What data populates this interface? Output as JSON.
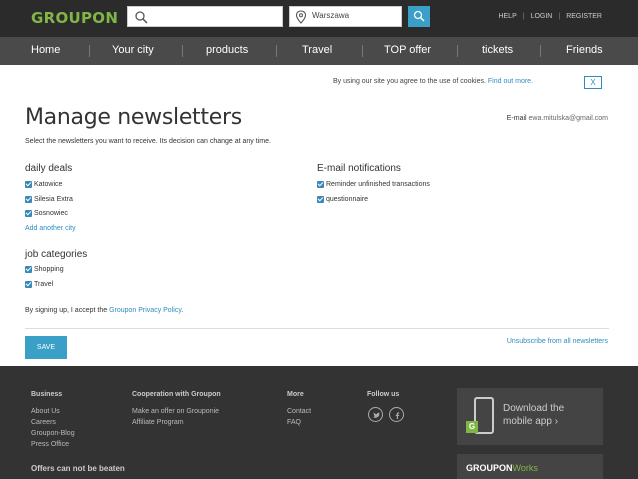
{
  "header": {
    "logo": "GROUPON",
    "search_placeholder": "",
    "location_value": "Warszawa",
    "links": [
      "HELP",
      "LOGIN",
      "REGISTER"
    ]
  },
  "nav": {
    "items": [
      "Home",
      "Your city",
      "products",
      "Travel",
      "TOP offer",
      "tickets",
      "Friends"
    ]
  },
  "cookie": {
    "text": "By using our site you agree to the use of cookies.",
    "link": "Find out more.",
    "close": "X"
  },
  "main": {
    "title": "Manage newsletters",
    "email_label": "E-mail",
    "email_value": "ewa.mitulska@gmail.com",
    "subtitle": "Select the newsletters you want to receive. Its decision can change at any time.",
    "daily_deals": {
      "heading": "daily deals",
      "items": [
        "Katowice",
        "Silesia Extra",
        "Sosnowiec"
      ],
      "add_link": "Add another city"
    },
    "email_notifications": {
      "heading": "E-mail notifications",
      "items": [
        "Reminder unfinished transactions",
        "questionnaire"
      ]
    },
    "job_categories": {
      "heading": "job categories",
      "items": [
        "Shopping",
        "Travel"
      ]
    },
    "terms_text": "By signing up, I accept the",
    "terms_link": "Groupon Privacy Policy",
    "terms_end": ".",
    "save_label": "SAVE",
    "unsubscribe_label": "Unsubscribe from all newsletters"
  },
  "footer": {
    "business": {
      "heading": "Business",
      "items": [
        "About Us",
        "Careers",
        "Groupon-Blog",
        "Press Office"
      ]
    },
    "cooperation": {
      "heading": "Cooperation with Groupon",
      "items": [
        "Make an offer on Grouponie",
        "Affiliate Program"
      ]
    },
    "more": {
      "heading": "More",
      "items": [
        "Contact",
        "FAQ"
      ]
    },
    "follow": {
      "heading": "Follow us"
    },
    "app_badge": "G",
    "app_line1": "Download the",
    "app_line2": "mobile app ›",
    "works_brand": "GROUPON",
    "works_word": "Works",
    "offers": "Offers can not be beaten"
  },
  "colors": {
    "brand_green": "#82b548",
    "accent_blue": "#3aa0c8",
    "link_blue": "#2d8cbf"
  }
}
